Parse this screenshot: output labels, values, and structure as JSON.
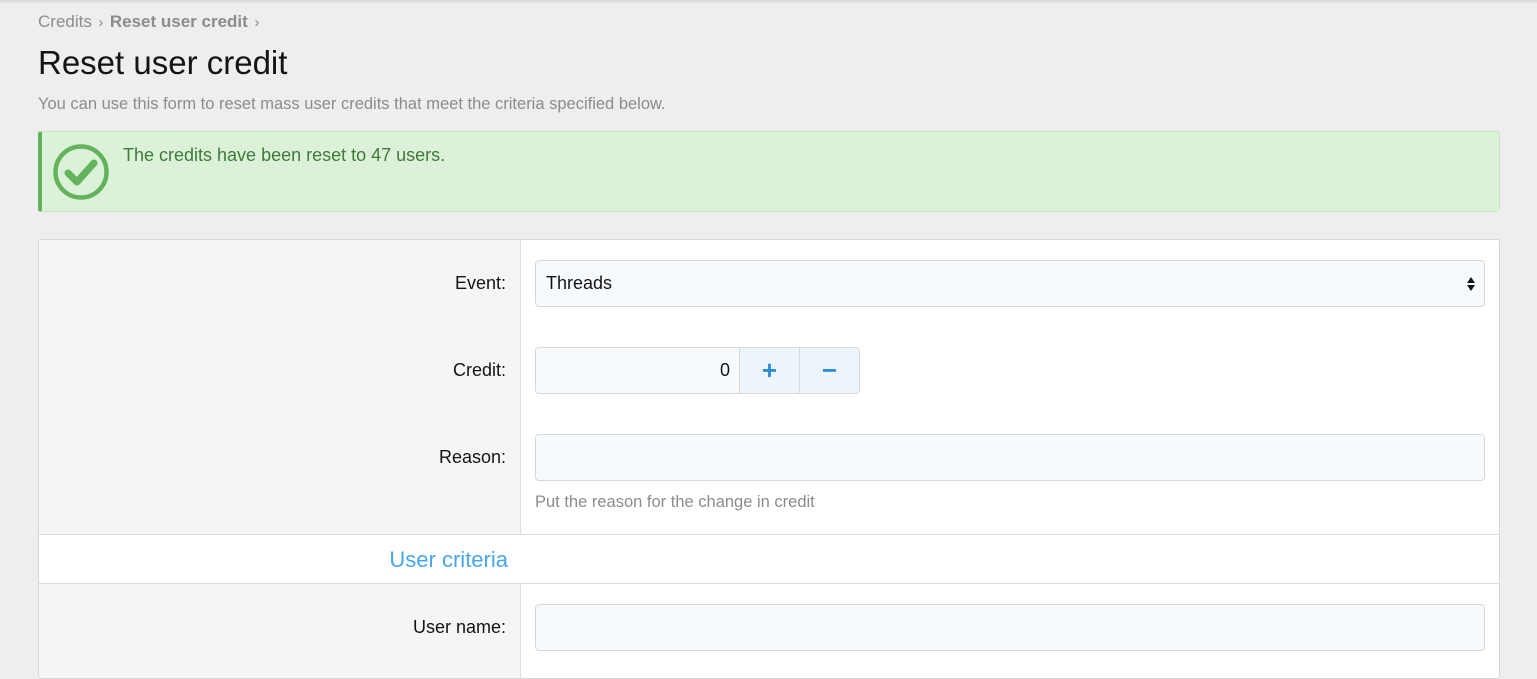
{
  "breadcrumb": {
    "items": [
      {
        "label": "Credits"
      },
      {
        "label": "Reset user credit"
      }
    ],
    "separator": "›"
  },
  "page": {
    "title": "Reset user credit",
    "description": "You can use this form to reset mass user credits that meet the criteria specified below."
  },
  "alert": {
    "type": "success",
    "icon": "check-circle-icon",
    "message": "The credits have been reset to 47 users.",
    "color": "#63b35c"
  },
  "form": {
    "event": {
      "label": "Event:",
      "value": "Threads"
    },
    "credit": {
      "label": "Credit:",
      "value": "0",
      "increment_label": "+",
      "decrement_label": "−"
    },
    "reason": {
      "label": "Reason:",
      "value": "",
      "hint": "Put the reason for the change in credit"
    },
    "user_criteria": {
      "title": "User criteria"
    },
    "user_name": {
      "label": "User name:",
      "value": ""
    }
  },
  "colors": {
    "accent": "#47a7eb",
    "success_bg": "#dbf2d8",
    "success_text": "#3f7a39"
  }
}
